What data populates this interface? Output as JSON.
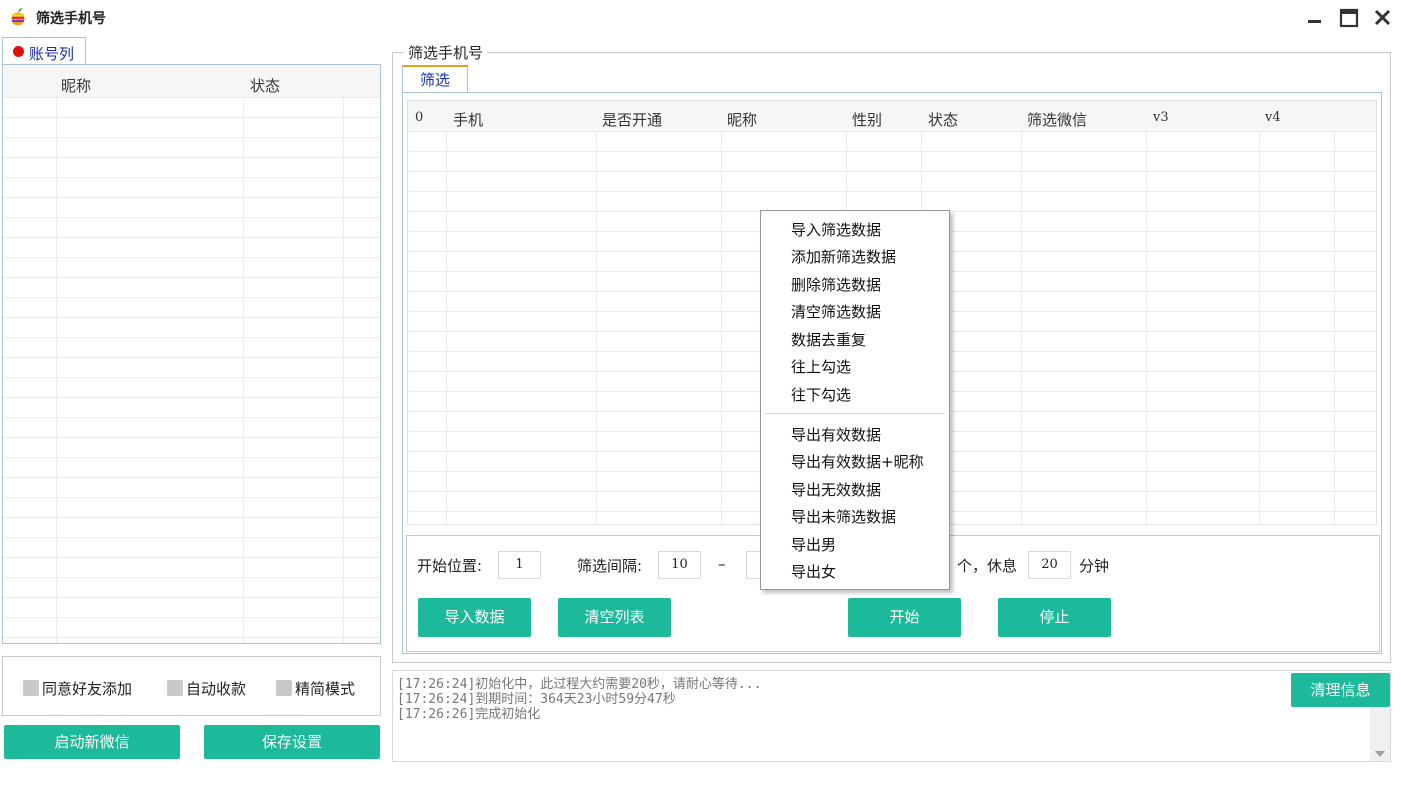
{
  "window": {
    "title": "筛选手机号",
    "accent_color": "#1cba9a"
  },
  "left": {
    "tab_label": "账号列",
    "columns": [
      "昵称",
      "状态"
    ],
    "options": [
      "同意好友添加",
      "自动收款",
      "精简模式"
    ],
    "buttons": {
      "start_wechat": "启动新微信",
      "save_settings": "保存设置"
    }
  },
  "right": {
    "group_title": "筛选手机号",
    "tab_label": "筛选",
    "columns": [
      "0",
      "手机",
      "是否开通",
      "昵称",
      "性别",
      "状态",
      "筛选微信",
      "v3",
      "v4"
    ],
    "controls": {
      "start_pos_label": "开始位置:",
      "start_pos_value": "1",
      "interval_label": "筛选间隔:",
      "interval_from": "10",
      "dash": "–",
      "count_suffix": "个，休息",
      "rest_value": "20",
      "minute_label": "分钟"
    },
    "buttons": {
      "import": "导入数据",
      "clear": "清空列表",
      "start": "开始",
      "stop": "停止"
    }
  },
  "log": {
    "lines": [
      "[17:26:24]初始化中，此过程大约需要20秒，请耐心等待...",
      "[17:26:24]到期时间：364天23小时59分47秒",
      "[17:26:26]完成初始化"
    ],
    "clear_button": "清理信息"
  },
  "context_menu": {
    "group1": [
      "导入筛选数据",
      "添加新筛选数据",
      "删除筛选数据",
      "清空筛选数据",
      "数据去重复",
      "往上勾选",
      "往下勾选"
    ],
    "group2": [
      "导出有效数据",
      "导出有效数据+昵称",
      "导出无效数据",
      "导出未筛选数据",
      "导出男",
      "导出女"
    ]
  }
}
